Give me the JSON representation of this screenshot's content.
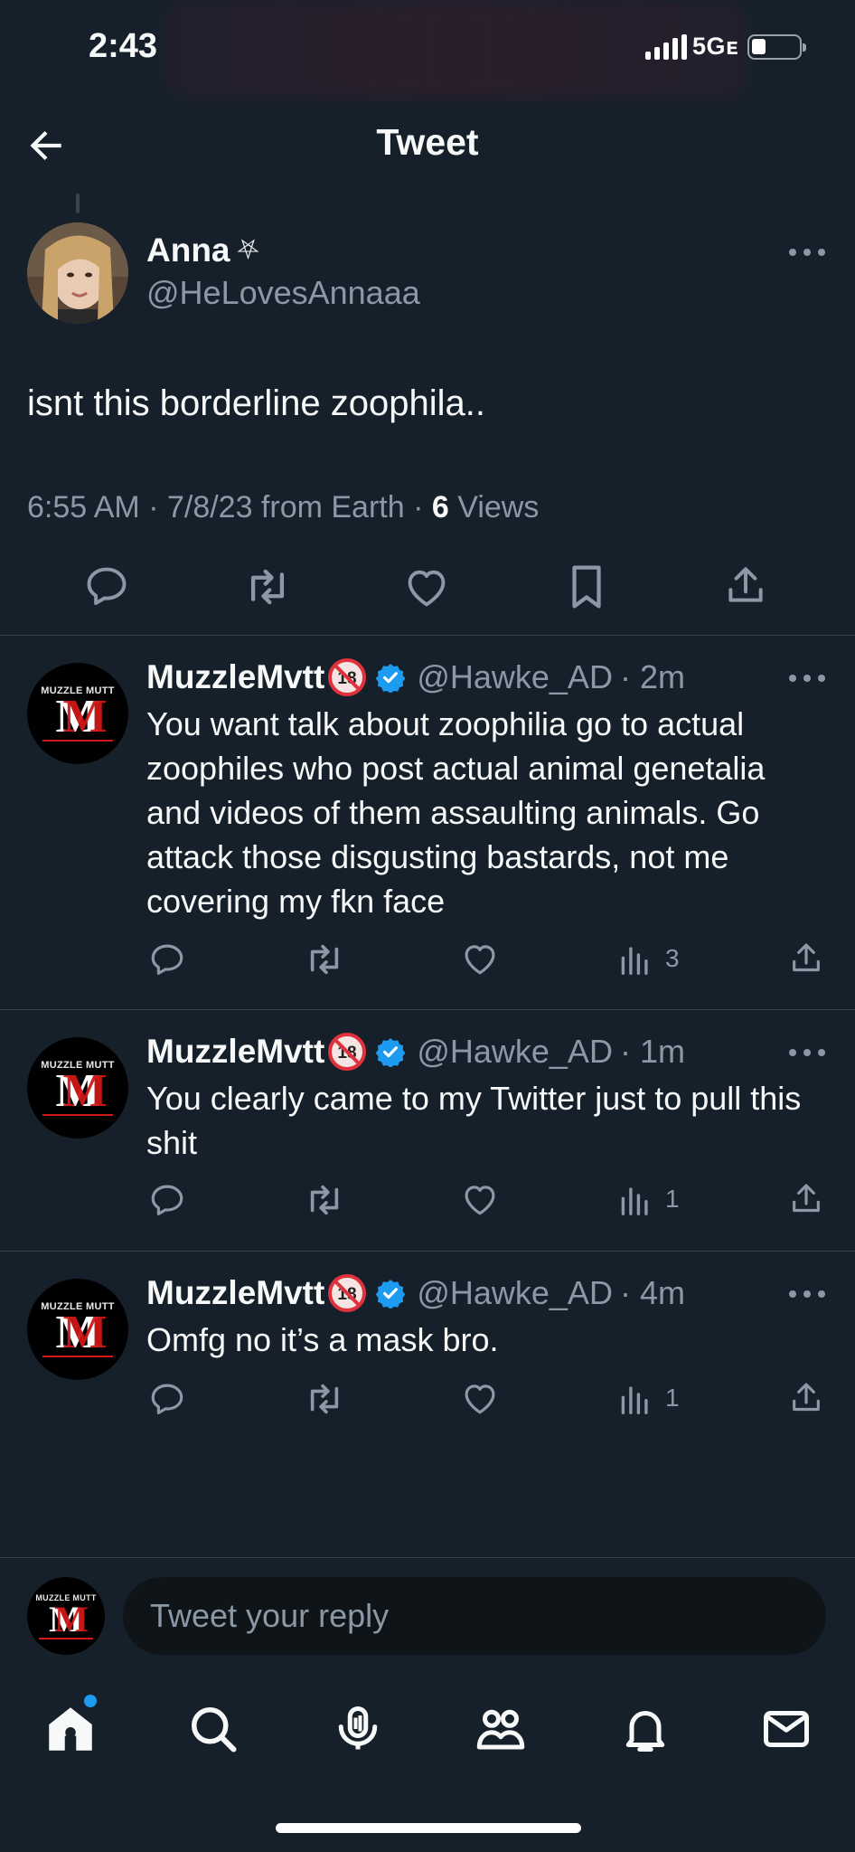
{
  "status_bar": {
    "time": "2:43",
    "network": "5Gᴇ"
  },
  "header": {
    "title": "Tweet"
  },
  "main_tweet": {
    "display_name": "Anna",
    "name_emoji": "⛧",
    "handle": "@HeLovesAnnaaa",
    "text": "isnt this borderline zoophila..",
    "timestamp": "6:55 AM · 7/8/23 from Earth ·",
    "views_count": "6",
    "views_label": "Views",
    "actions": [
      "reply-icon",
      "retweet-icon",
      "like-icon",
      "bookmark-icon",
      "share-icon"
    ]
  },
  "replies": [
    {
      "display_name": "MuzzleMvtt",
      "handle": "@Hawke_AD",
      "time": "· 2m",
      "text": "You want talk about zoophilia go to actual zoophiles who post actual animal genetalia and videos of them assaulting animals. Go attack those disgusting bastards, not me covering my fkn face",
      "views": "3"
    },
    {
      "display_name": "MuzzleMvtt",
      "handle": "@Hawke_AD",
      "time": "· 1m",
      "text": "You clearly came to my Twitter just to pull this shit",
      "views": "1"
    },
    {
      "display_name": "MuzzleMvtt",
      "handle": "@Hawke_AD",
      "time": "· 4m",
      "text": "Omfg no it’s a mask bro.",
      "views": "1"
    }
  ],
  "avatar_logo": {
    "top_text": "MUZZLE MUTT",
    "letters": "M"
  },
  "reply_bar": {
    "placeholder": "Tweet your reply"
  },
  "bottom_nav": [
    "home-icon",
    "search-icon",
    "spaces-icon",
    "communities-icon",
    "notifications-icon",
    "messages-icon"
  ],
  "colors": {
    "background": "#15202b",
    "accent": "#1d9bf0",
    "muted": "#8b98a5",
    "divider": "#38444d"
  }
}
